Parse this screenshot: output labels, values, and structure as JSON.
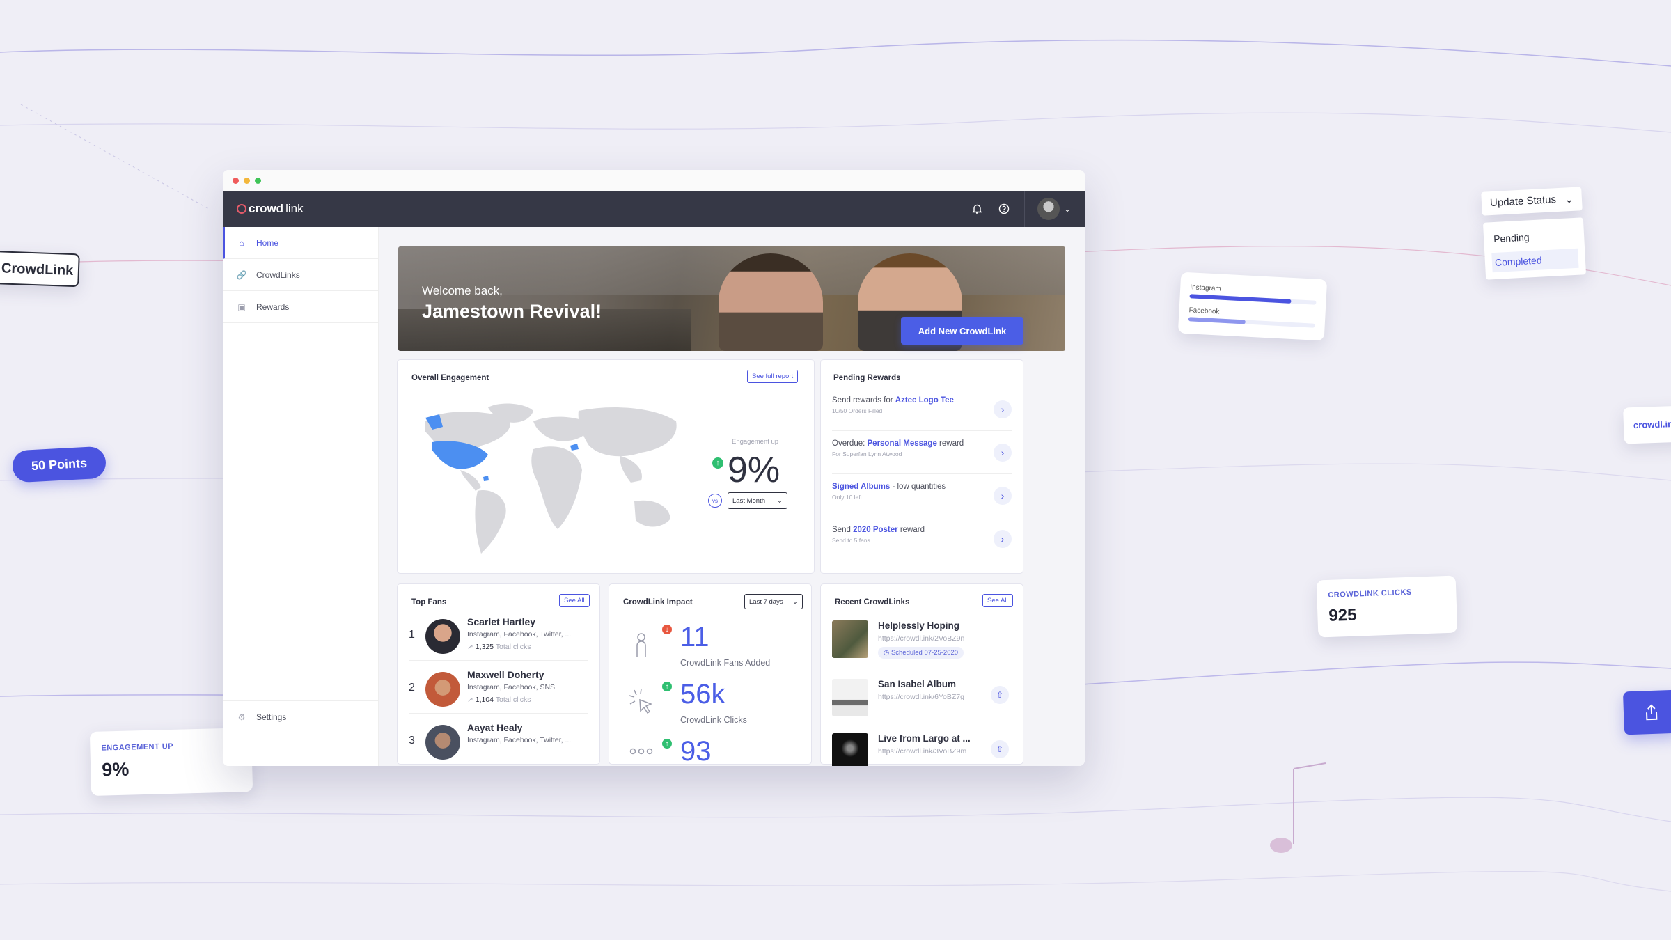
{
  "app": {
    "logo_text_bold": "crowd",
    "logo_text_light": "link"
  },
  "floating": {
    "crowdlink_tag": "CrowdLink",
    "points_pill": "50 Points",
    "engagement_caption": "ENGAGEMENT UP",
    "engagement_value": "9%",
    "clicks_caption": "CROWDLINK CLICKS",
    "clicks_value": "925",
    "update_status": "Update Status",
    "status_options": [
      "Pending",
      "Completed"
    ],
    "social": [
      {
        "label": "Instagram",
        "value": 0.8,
        "color": "#4b54e0"
      },
      {
        "label": "Facebook",
        "value": 0.45,
        "color": "#8e96ee"
      }
    ],
    "crowdl_link": "crowdl.in"
  },
  "sidebar": {
    "items": [
      {
        "label": "Home",
        "icon": "home-icon"
      },
      {
        "label": "CrowdLinks",
        "icon": "link-icon"
      },
      {
        "label": "Rewards",
        "icon": "gift-icon"
      }
    ],
    "settings": "Settings"
  },
  "hero": {
    "greeting": "Welcome back,",
    "name": "Jamestown Revival!",
    "add_button": "Add New CrowdLink"
  },
  "engagement": {
    "title": "Overall Engagement",
    "report_button": "See full report",
    "caption": "Engagement up",
    "value": "9%",
    "vs": "vs",
    "period": "Last Month"
  },
  "rewards": {
    "title": "Pending Rewards",
    "items": [
      {
        "pre": "Send rewards for ",
        "highlight": "Aztec Logo Tee",
        "post": "",
        "sub": "10/50 Orders Filled"
      },
      {
        "pre": "Overdue: ",
        "highlight": "Personal Message",
        "post": " reward",
        "sub": "For Superfan Lynn Atwood"
      },
      {
        "pre": "",
        "highlight": "Signed Albums",
        "post": " - low quantities",
        "sub": "Only 10 left"
      },
      {
        "pre": "Send ",
        "highlight": "2020 Poster",
        "post": " reward",
        "sub": "Send to 5 fans"
      }
    ]
  },
  "top_fans": {
    "title": "Top Fans",
    "see_all": "See All",
    "items": [
      {
        "rank": "1",
        "name": "Scarlet Hartley",
        "networks": "Instagram, Facebook, Twitter, ...",
        "clicks": "1,325",
        "clicks_label": "Total clicks"
      },
      {
        "rank": "2",
        "name": "Maxwell Doherty",
        "networks": "Instagram, Facebook, SNS",
        "clicks": "1,104",
        "clicks_label": "Total clicks"
      },
      {
        "rank": "3",
        "name": "Aayat Healy",
        "networks": "Instagram, Facebook, Twitter, ...",
        "clicks": "",
        "clicks_label": ""
      }
    ]
  },
  "impact": {
    "title": "CrowdLink Impact",
    "period": "Last 7 days",
    "items": [
      {
        "value": "11",
        "label": "CrowdLink Fans Added",
        "trend": "down"
      },
      {
        "value": "56k",
        "label": "CrowdLink Clicks",
        "trend": "up"
      },
      {
        "value": "93",
        "label": "",
        "trend": "up"
      }
    ]
  },
  "recent": {
    "title": "Recent CrowdLinks",
    "see_all": "See All",
    "items": [
      {
        "title": "Helplessly Hoping",
        "url": "https://crowdl.ink/2VoBZ9n",
        "scheduled": "Scheduled 07-25-2020"
      },
      {
        "title": "San Isabel Album",
        "url": "https://crowdl.ink/6YoBZ7g",
        "scheduled": ""
      },
      {
        "title": "Live from Largo at ...",
        "url": "https://crowdl.ink/3VoBZ9m",
        "scheduled": ""
      }
    ]
  }
}
